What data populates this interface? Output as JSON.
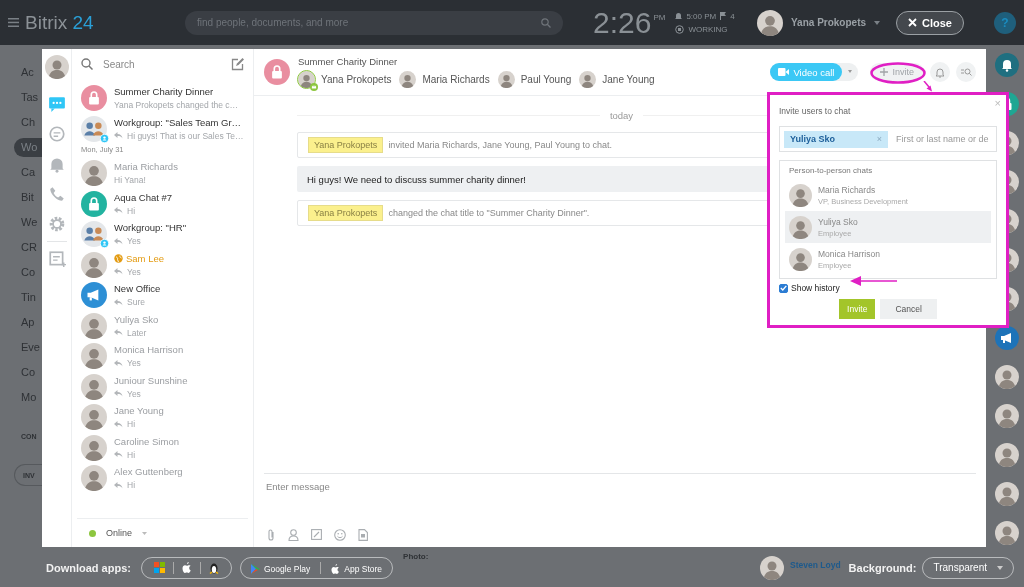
{
  "top_bar": {
    "logo": {
      "text": "Bitrix",
      "number": "24"
    },
    "search": {
      "placeholder": "find people, documents, and more"
    },
    "clock": {
      "time": "2:26",
      "period": "PM"
    },
    "alarm": "5:00 PM",
    "flags": "4",
    "work_status": "WORKING",
    "user": "Yana Prokopets",
    "close_button": "Close",
    "help_button": "?"
  },
  "left_nav": {
    "items": [
      {
        "label": "Ac",
        "selected": false
      },
      {
        "label": "Tas",
        "selected": false
      },
      {
        "label": "Ch",
        "selected": false
      },
      {
        "label": "Wo",
        "selected": true
      },
      {
        "label": "Ca",
        "selected": false
      },
      {
        "label": "Bit",
        "selected": false
      },
      {
        "label": "We",
        "selected": false
      },
      {
        "label": "CR",
        "selected": false
      },
      {
        "label": "Co",
        "selected": false
      },
      {
        "label": "Tin",
        "selected": false
      },
      {
        "label": "Ap",
        "selected": false
      },
      {
        "label": "Eve",
        "selected": false
      },
      {
        "label": "Co",
        "selected": false
      },
      {
        "label": "Mo",
        "selected": false
      }
    ],
    "section": "CON",
    "invite_button": "INV"
  },
  "messenger": {
    "rail": [
      {
        "kind": "chat",
        "selected": true
      },
      {
        "kind": "history",
        "selected": false
      },
      {
        "kind": "bell",
        "selected": false
      },
      {
        "kind": "phone",
        "selected": false
      },
      {
        "kind": "gear",
        "selected": false
      },
      {
        "kind": "notes",
        "selected": false
      }
    ],
    "chat_list": {
      "search": {
        "placeholder": "Search"
      },
      "items": [
        {
          "kind": "lock",
          "name": "Summer Charity Dinner",
          "preview": "Yana Prokopets changed the c…",
          "color": "#e98ea0",
          "muted": false,
          "extranet": false,
          "reply": false,
          "badge": false
        },
        {
          "kind": "group",
          "name": "Workgroup: \"Sales Team Gr…",
          "preview": "Hi guys! That is our Sales Te…",
          "muted": false,
          "extranet": false,
          "reply": true,
          "badge": true
        },
        {
          "kind": "date",
          "label": "Mon, July 31"
        },
        {
          "kind": "person",
          "name": "Maria Richards",
          "preview": "Hi Yana!",
          "muted": true,
          "extranet": false,
          "reply": false,
          "badge": false
        },
        {
          "kind": "lock",
          "name": "Aqua Chat #7",
          "preview": "Hi",
          "color": "#22b3a0",
          "muted": false,
          "extranet": false,
          "reply": true,
          "badge": false
        },
        {
          "kind": "group",
          "name": "Workgroup: \"HR\"",
          "preview": "Yes",
          "muted": false,
          "extranet": false,
          "reply": true,
          "badge": true
        },
        {
          "kind": "person",
          "name": "Sam Lee",
          "preview": "Yes",
          "extranet": true,
          "reply": true,
          "badge": false
        },
        {
          "kind": "megaphone",
          "name": "New Office",
          "preview": "Sure",
          "color": "#2d8fd5",
          "muted": false,
          "extranet": false,
          "reply": true,
          "badge": false
        },
        {
          "kind": "person",
          "name": "Yuliya Sko",
          "preview": "Later",
          "muted": true,
          "extranet": false,
          "reply": true,
          "badge": false
        },
        {
          "kind": "person",
          "name": "Monica Harrison",
          "preview": "Yes",
          "muted": true,
          "extranet": false,
          "reply": true,
          "badge": false
        },
        {
          "kind": "person",
          "name": "Juniour Sunshine",
          "preview": "Yes",
          "muted": true,
          "extranet": false,
          "reply": true,
          "badge": false
        },
        {
          "kind": "person",
          "name": "Jane Young",
          "preview": "Hi",
          "muted": true,
          "extranet": false,
          "reply": true,
          "badge": false
        },
        {
          "kind": "person",
          "name": "Caroline Simon",
          "preview": "Hi",
          "muted": true,
          "extranet": false,
          "reply": true,
          "badge": false
        },
        {
          "kind": "person",
          "name": "Alex Guttenberg",
          "preview": "Hi",
          "muted": true,
          "extranet": false,
          "reply": true,
          "badge": false
        }
      ],
      "status": "Online"
    },
    "chat": {
      "title": "Summer Charity Dinner",
      "color": "#e98ea0",
      "members": [
        {
          "name": "Yana Prokopets",
          "online": true,
          "owner": true
        },
        {
          "name": "Maria Richards",
          "online": false,
          "owner": false
        },
        {
          "name": "Paul Young",
          "online": false,
          "owner": false
        },
        {
          "name": "Jane Young",
          "online": false,
          "owner": false
        }
      ],
      "video_call_button": "Video call",
      "invite_button": "Invite",
      "date_separator": "today",
      "messages": [
        {
          "kind": "system",
          "author": "Yana Prokopets",
          "text": "invited Maria Richards, Jane Young, Paul Young to chat."
        },
        {
          "kind": "text",
          "text": "Hi guys! We need to discuss summer charity dinner!"
        },
        {
          "kind": "system",
          "author": "Yana Prokopets",
          "text": "changed the chat title to \"Summer Charity Dinner\"."
        }
      ],
      "composer": {
        "placeholder": "Enter message"
      }
    },
    "invite_popup": {
      "title": "Invite users to chat",
      "close": "×",
      "token": "Yuliya Sko",
      "token_remove": "×",
      "input_placeholder": "First or last name or de",
      "section": "Person-to-person chats",
      "people": [
        {
          "name": "Maria Richards",
          "role": "VP, Business Development",
          "selected": false
        },
        {
          "name": "Yuliya Sko",
          "role": "Employee",
          "selected": true
        },
        {
          "name": "Monica Harrison",
          "role": "Employee",
          "selected": false
        }
      ],
      "show_history": {
        "label": "Show history",
        "checked": true
      },
      "invite_button": "Invite",
      "cancel_button": "Cancel"
    }
  },
  "right_strip": [
    {
      "kind": "bell"
    },
    {
      "kind": "lock"
    },
    {
      "kind": "person"
    },
    {
      "kind": "person"
    },
    {
      "kind": "person"
    },
    {
      "kind": "person"
    },
    {
      "kind": "person"
    },
    {
      "kind": "megaphone"
    },
    {
      "kind": "person"
    },
    {
      "kind": "person"
    },
    {
      "kind": "person"
    },
    {
      "kind": "person"
    },
    {
      "kind": "person"
    }
  ],
  "bottom_bar": {
    "download_label": "Download apps:",
    "google_play": "Google Play",
    "app_store": "App Store",
    "photo_label": "Photo:",
    "contact": "Steven Loyd",
    "background_label": "Background:",
    "background_value": "Transparent"
  }
}
